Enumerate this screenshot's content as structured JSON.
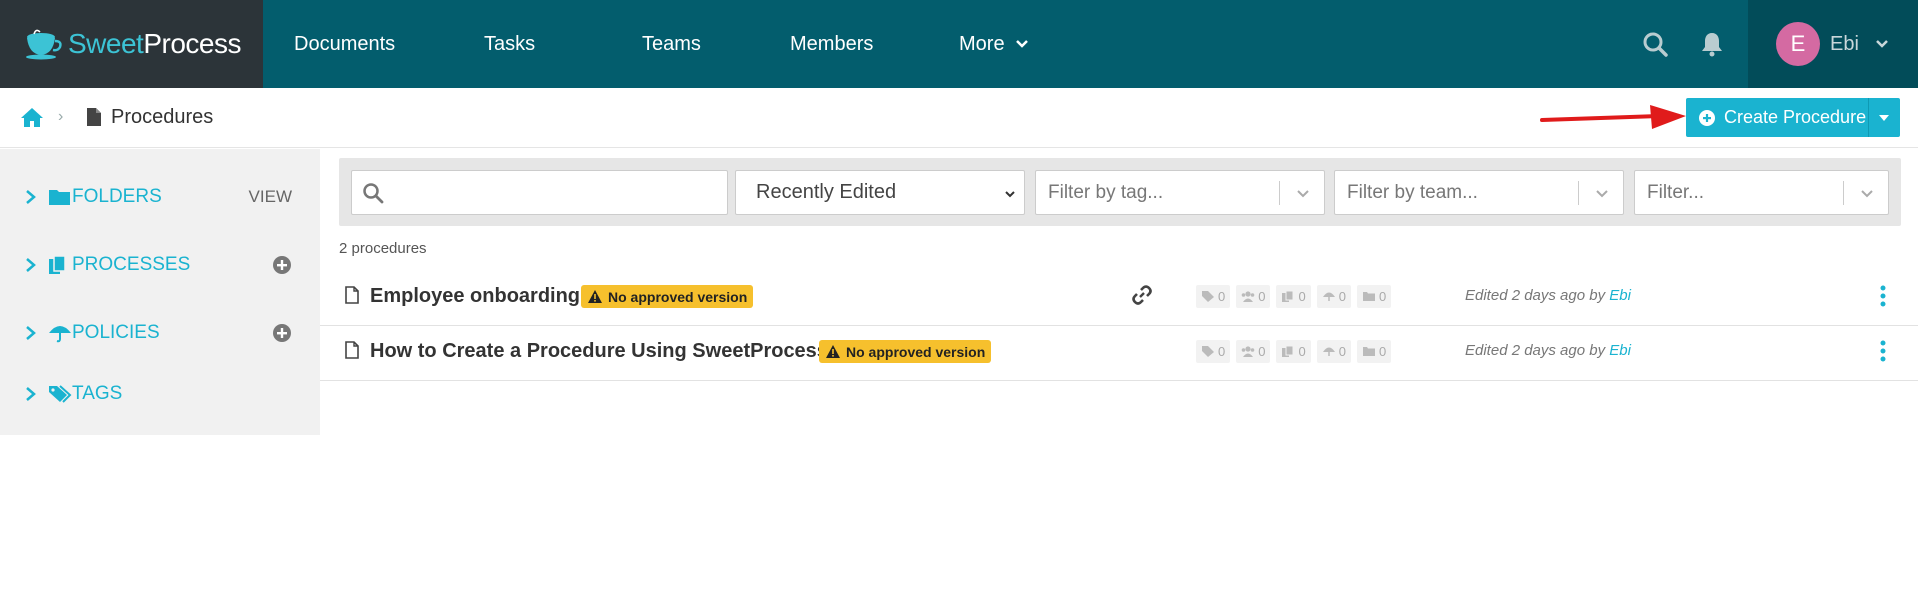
{
  "brand": {
    "name_part1": "Sweet",
    "name_part2": "Process"
  },
  "nav": {
    "documents": "Documents",
    "tasks": "Tasks",
    "teams": "Teams",
    "members": "Members",
    "more": "More"
  },
  "user": {
    "initial": "E",
    "name": "Ebi"
  },
  "breadcrumb": {
    "current": "Procedures"
  },
  "create_button": {
    "label": "Create Procedure"
  },
  "sidebar": {
    "folders": {
      "label": "FOLDERS",
      "action": "VIEW"
    },
    "processes": {
      "label": "PROCESSES"
    },
    "policies": {
      "label": "POLICIES"
    },
    "tags": {
      "label": "TAGS"
    }
  },
  "filters": {
    "search_value": "",
    "sort_selected": "Recently Edited",
    "tag_placeholder": "Filter by tag...",
    "team_placeholder": "Filter by team...",
    "generic_placeholder": "Filter..."
  },
  "list": {
    "count_text": "2 procedures",
    "badge_text": "No approved version",
    "rows": [
      {
        "title": "Employee onboarding",
        "tags": "0",
        "members": "0",
        "processes": "0",
        "policies": "0",
        "folders": "0",
        "edited": "Edited 2 days ago by",
        "editor": "Ebi"
      },
      {
        "title": "How to Create a Procedure Using SweetProcess",
        "tags": "0",
        "members": "0",
        "processes": "0",
        "policies": "0",
        "folders": "0",
        "edited": "Edited 2 days ago by",
        "editor": "Ebi"
      }
    ]
  },
  "colors": {
    "topbar": "#035d6d",
    "accent": "#1ab3d0",
    "badge": "#f6c02d",
    "annotation_arrow": "#e01b1b"
  }
}
